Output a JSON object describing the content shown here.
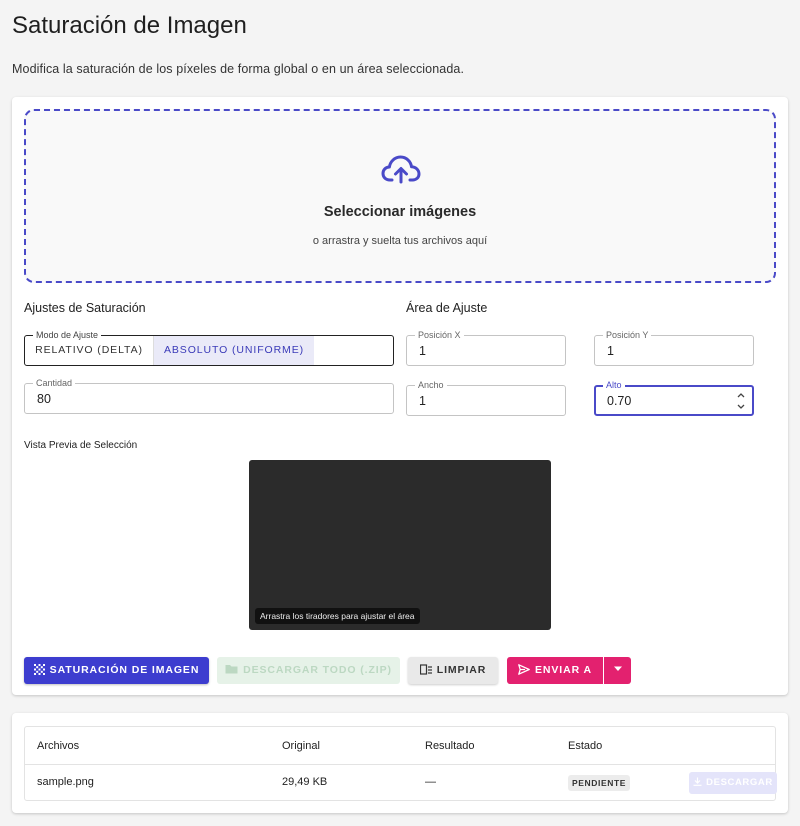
{
  "header": {
    "title": "Saturación de Imagen",
    "description": "Modifica la saturación de los píxeles de forma global o en un área seleccionada."
  },
  "dropzone": {
    "icon": "cloud-upload-icon",
    "title": "Seleccionar imágenes",
    "subtitle": "o arrastra y suelta tus archivos aquí"
  },
  "saturation": {
    "section_title": "Ajustes de Saturación",
    "mode_label": "Modo de Ajuste",
    "mode_options": [
      "RELATIVO (DELTA)",
      "ABSOLUTO (UNIFORME)"
    ],
    "mode_selected": "ABSOLUTO (UNIFORME)",
    "amount_label": "Cantidad",
    "amount_value": "80"
  },
  "area": {
    "section_title": "Área de Ajuste",
    "pos_x_label": "Posición X",
    "pos_x_value": "1",
    "pos_y_label": "Posición Y",
    "pos_y_value": "1",
    "width_label": "Ancho",
    "width_value": "1",
    "height_label": "Alto",
    "height_value": "0.70"
  },
  "preview": {
    "label": "Vista Previa de Selección",
    "hint": "Arrastra los tiradores para ajustar el área"
  },
  "actions": {
    "saturation_button": "SATURACIÓN DE IMAGEN",
    "download_all_button": "DESCARGAR TODO (.ZIP)",
    "clear_button": "LIMPIAR",
    "send_button": "ENVIAR A"
  },
  "table": {
    "headers": [
      "Archivos",
      "Original",
      "Resultado",
      "Estado"
    ],
    "rows": [
      {
        "file": "sample.png",
        "original": "29,49 KB",
        "result": "—",
        "status": "PENDIENTE",
        "download": "DESCARGAR"
      }
    ]
  },
  "colors": {
    "accent": "#3d3dcf",
    "send": "#e3216f",
    "download_disabled": "#e6f2e8"
  }
}
